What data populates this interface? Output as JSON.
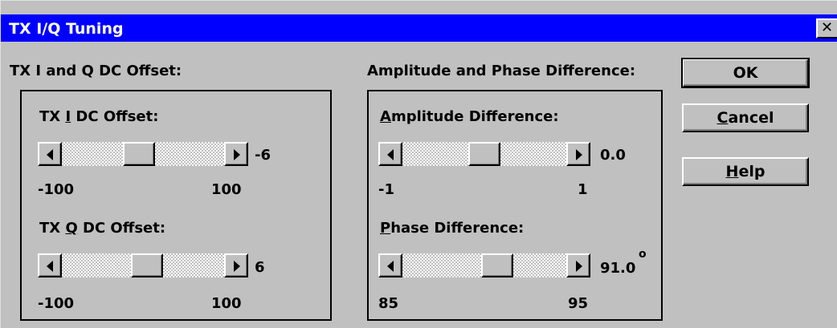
{
  "window": {
    "title": "TX I/Q Tuning",
    "close_glyph": "✕"
  },
  "left_section": {
    "heading": "TX I and Q DC Offset:",
    "i_offset": {
      "label_prefix": "TX ",
      "label_key": "I",
      "label_suffix": " DC Offset:",
      "value": "-6",
      "min": "-100",
      "max": "100",
      "level": -6
    },
    "q_offset": {
      "label_prefix": "TX ",
      "label_key": "Q",
      "label_suffix": " DC Offset:",
      "value": "6",
      "min": "-100",
      "max": "100",
      "level": 6
    }
  },
  "right_section": {
    "heading": "Amplitude and Phase Difference:",
    "amplitude": {
      "label_key": "A",
      "label_rest": "mplitude Difference:",
      "value": "0.0",
      "min": "-1",
      "max": "1",
      "level": 0.0
    },
    "phase": {
      "label_key": "P",
      "label_rest": "hase Difference:",
      "value": "91.0",
      "unit": "o",
      "min": "85",
      "max": "95",
      "level": 91.0
    }
  },
  "buttons": {
    "ok": "OK",
    "cancel_key": "C",
    "cancel_rest": "ancel",
    "help_key": "H",
    "help_rest": "elp"
  },
  "colors": {
    "titlebar": "#0000ff",
    "face": "#c0c0c0"
  }
}
